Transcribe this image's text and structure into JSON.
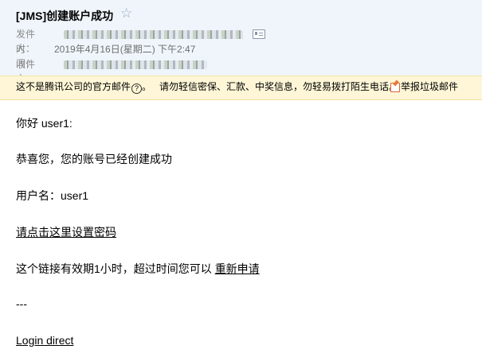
{
  "email": {
    "subject": "[JMS]创建账户成功",
    "star_icon": "star-outline-icon",
    "sender_label": "发件人：",
    "time_label": "时　间：",
    "time_value": "2019年4月16日(星期二) 下午2:47",
    "recipient_label": "收件人：",
    "card_icon": "contact-card-icon"
  },
  "warning": {
    "text": "这不是腾讯公司的官方邮件",
    "help_glyph": "?",
    "tip": "请勿轻信密保、汇款、中奖信息，勿轻易拨打陌生电话。",
    "report_label": "举报垃圾邮件"
  },
  "content": {
    "greeting": "你好 user1:",
    "congrats": "恭喜您，您的账号已经创建成功",
    "username": "用户名：user1",
    "set_password_link": "请点击这里设置密码",
    "expiry_text": "这个链接有效期1小时，超过时间您可以",
    "reapply_link": "重新申请",
    "separator": "---",
    "login_link": "Login direct"
  }
}
